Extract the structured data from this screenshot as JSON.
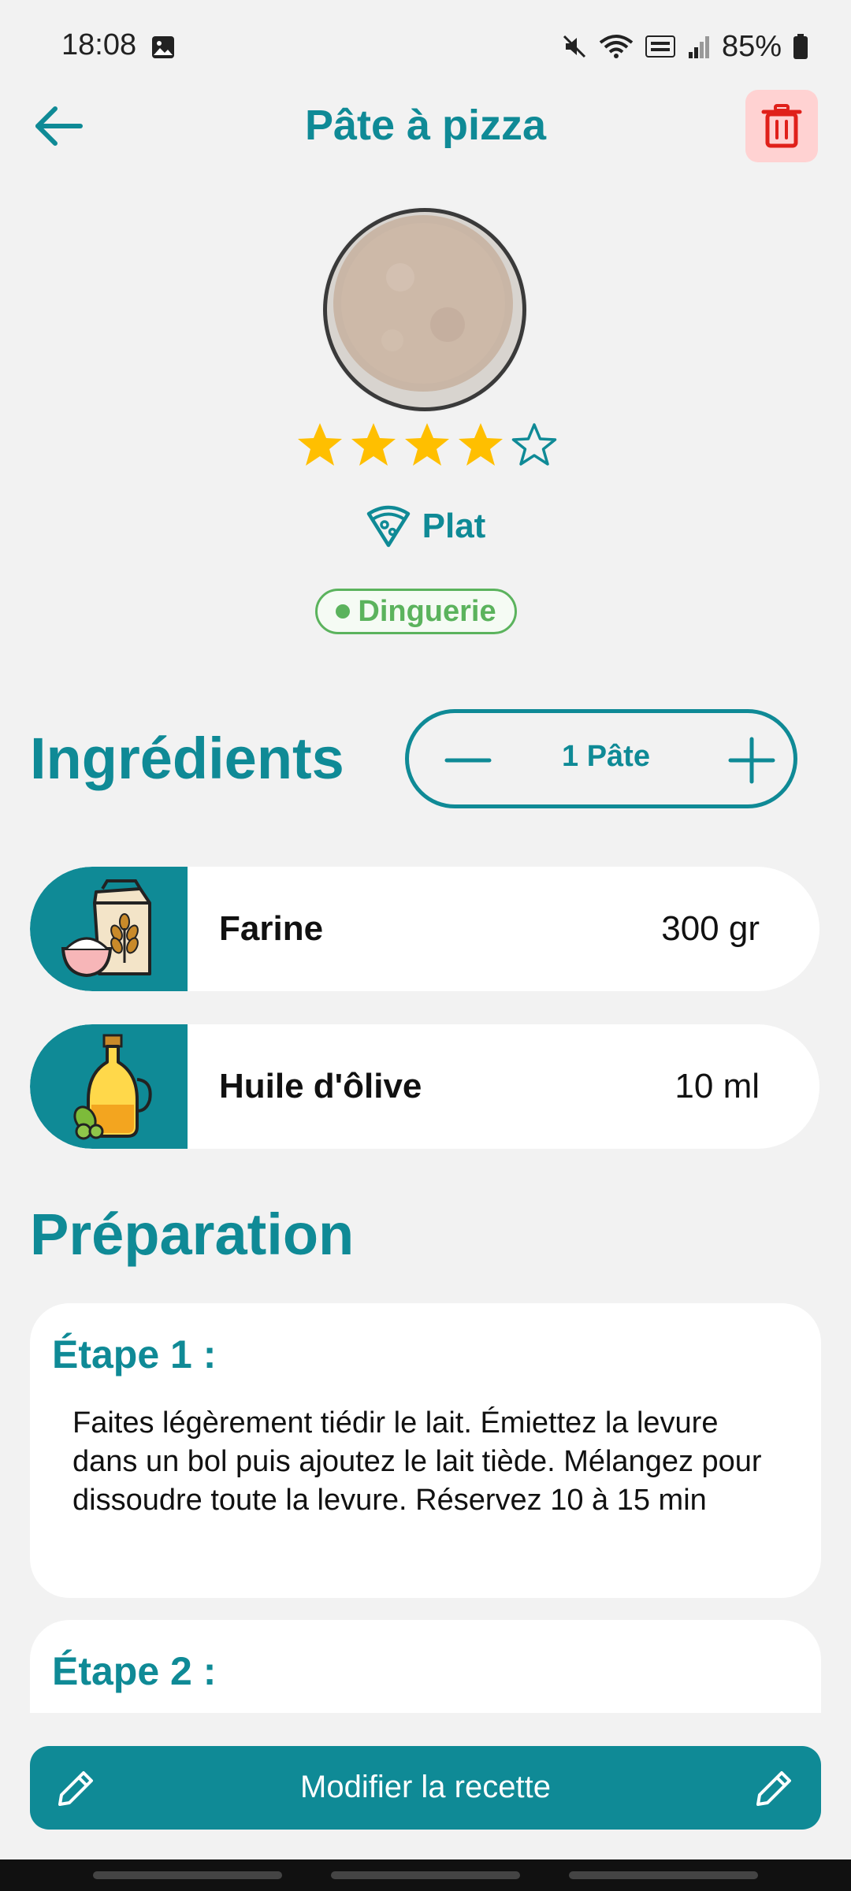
{
  "status": {
    "time": "18:08",
    "battery": "85%"
  },
  "header": {
    "title": "Pâte à pizza"
  },
  "rating": {
    "value": 4,
    "max": 5
  },
  "category": {
    "label": "Plat"
  },
  "tag": {
    "label": "Dinguerie"
  },
  "ingredients": {
    "title": "Ingrédients",
    "portion": "1 Pâte",
    "items": [
      {
        "name": "Farine",
        "quantity": "300 gr"
      },
      {
        "name": "Huile d'ôlive",
        "quantity": "10 ml"
      }
    ]
  },
  "preparation": {
    "title": "Préparation",
    "steps": [
      {
        "title": "Étape 1 :",
        "text": "Faites légèrement tiédir le lait. Émiettez la levure dans un bol puis ajoutez le lait tiède. Mélangez pour dissoudre toute la levure. Réservez 10 à 15 min"
      },
      {
        "title": "Étape 2 :",
        "text": ""
      }
    ]
  },
  "footer": {
    "edit_label": "Modifier la recette"
  },
  "colors": {
    "accent": "#0f8a96",
    "delete_bg": "#ffd2d2",
    "tag_green": "#5bb35d",
    "star": "#ffbf00"
  }
}
